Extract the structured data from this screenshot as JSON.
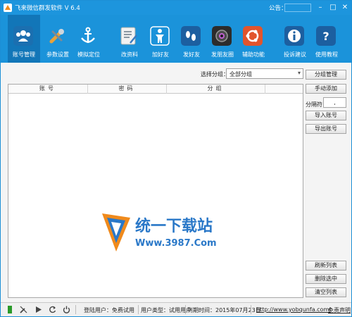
{
  "window": {
    "title": "飞来微信群发软件    V 6.4",
    "notice_label": "公告：",
    "min_glyph": "–",
    "max_glyph": "□",
    "close_glyph": "✕"
  },
  "toolbar": {
    "items": [
      {
        "label": "账号管理",
        "icon": "users-icon",
        "color": "#1b6fb0"
      },
      {
        "label": "参数设置",
        "icon": "wrench-icon",
        "color": "#1b93da"
      },
      {
        "label": "模拟定位",
        "icon": "anchor-icon",
        "color": "#1b93da"
      },
      {
        "label": "改资料",
        "icon": "profile-edit-icon",
        "color": "#e8e8e8"
      },
      {
        "label": "加好友",
        "icon": "person-add-icon",
        "color": "#1b93da"
      },
      {
        "label": "发好友",
        "icon": "footprints-icon",
        "color": "#1c5fa0"
      },
      {
        "label": "发朋友圈",
        "icon": "camera-icon",
        "color": "#2c2c2c"
      },
      {
        "label": "辅助功能",
        "icon": "ubuntu-icon",
        "color": "#e2542c"
      },
      {
        "label": "投诉建议",
        "icon": "info-icon",
        "color": "#1c5fa0"
      },
      {
        "label": "使用教程",
        "icon": "help-icon",
        "color": "#1c5fa0"
      }
    ]
  },
  "filter": {
    "label": "选择分组：",
    "selected": "全部分组"
  },
  "table": {
    "columns": [
      "账号",
      "密码",
      "分组"
    ],
    "rows": []
  },
  "watermark": {
    "text_main": "统一下载站",
    "text_url": "Www.3987.Com"
  },
  "side": {
    "group_manage": "分组管理",
    "manual_add": "手动添加",
    "separator_label": "分隔符",
    "separator_value": ",",
    "import_accounts": "导入账号",
    "export_accounts": "导出账号",
    "refresh_list": "刷新列表",
    "delete_selected": "删除选中",
    "clear_list": "清空列表"
  },
  "status": {
    "user": "登陆用户：免费试用",
    "user_type": "用户类型：试用用户",
    "expire": "到期时间：2015年07月23日",
    "website": "http://www.yobqunfa.com/",
    "disclaimer": "免责声明"
  }
}
